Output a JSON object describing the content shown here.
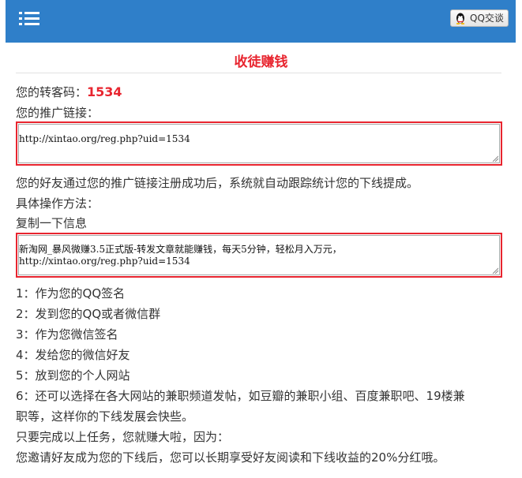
{
  "header": {
    "menu_icon": "hamburger-menu-icon",
    "qq_button_label": "QQ交谈",
    "qq_icon": "qq-penguin-icon"
  },
  "page": {
    "title": "收徒赚钱"
  },
  "referral": {
    "code_label": "您的转客码：",
    "code_value": "1534",
    "link_label": "您的推广链接：",
    "link_value": "http://xintao.org/reg.php?uid=1534",
    "description": "您的好友通过您的推广链接注册成功后，系统就自动跟踪统计您的下线提成。",
    "method_label": "具体操作方法：",
    "copy_label": "复制一下信息",
    "copy_text_line1": "新淘网_暴风微赚3.5正式版-转发文章就能赚钱，每天5分钟，轻松月入万元，",
    "copy_text_line2": "http://xintao.org/reg.php?uid=1534"
  },
  "steps": [
    "1：作为您的QQ签名",
    "2：发到您的QQ或者微信群",
    "3：作为您微信签名",
    "4：发给您的微信好友",
    "5：放到您的个人网站",
    "6：还可以选择在各大网站的兼职频道发帖，如豆瓣的兼职小组、百度兼职吧、19楼兼",
    "职等，这样你的下线发展会快些。"
  ],
  "footer": {
    "line1": "只要完成以上任务，您就赚大啦，因为：",
    "line2": "您邀请好友成为您的下线后，您可以长期享受好友阅读和下线收益的20%分红哦。"
  },
  "colors": {
    "header_bg": "#2f7fc9",
    "accent_red": "#e8252f"
  }
}
